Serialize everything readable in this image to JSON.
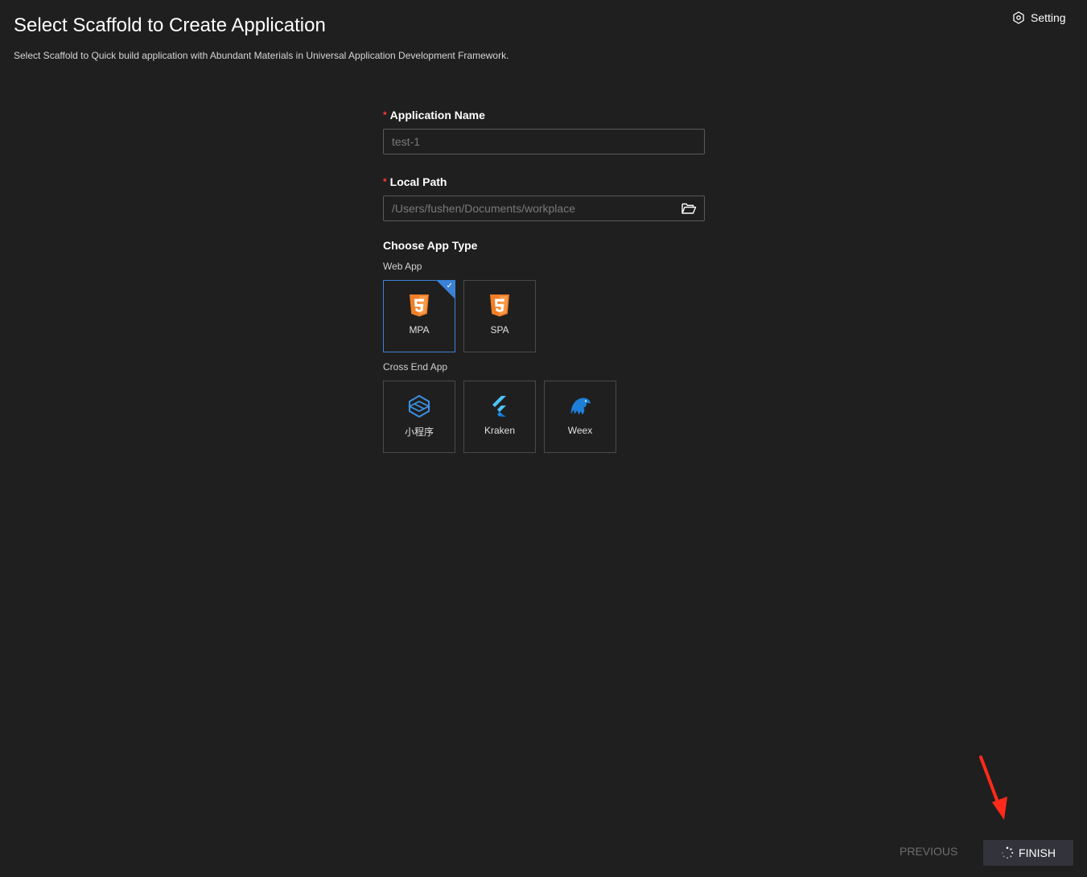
{
  "header": {
    "title": "Select Scaffold to Create Application",
    "subtitle": "Select Scaffold to Quick build application with Abundant Materials in Universal Application Development Framework.",
    "setting_label": "Setting"
  },
  "form": {
    "app_name": {
      "label": "Application Name",
      "required_mark": "*",
      "placeholder": "test-1"
    },
    "local_path": {
      "label": "Local Path",
      "required_mark": "*",
      "placeholder": "/Users/fushen/Documents/workplace"
    },
    "app_type": {
      "title": "Choose App Type",
      "web_group": {
        "label": "Web App",
        "items": [
          {
            "label": "MPA",
            "icon": "html5-icon",
            "selected": true
          },
          {
            "label": "SPA",
            "icon": "html5-icon",
            "selected": false
          }
        ]
      },
      "cross_group": {
        "label": "Cross End App",
        "items": [
          {
            "label": "小程序",
            "icon": "miniapp-icon"
          },
          {
            "label": "Kraken",
            "icon": "kraken-icon"
          },
          {
            "label": "Weex",
            "icon": "weex-icon"
          }
        ]
      }
    }
  },
  "footer": {
    "previous_label": "PREVIOUS",
    "finish_label": "FINISH"
  },
  "colors": {
    "background": "#1f1f1f",
    "accent": "#3b82d6",
    "html5": "#f07f28",
    "required": "#ff3b30",
    "annotation_arrow": "#ff2a1a"
  }
}
